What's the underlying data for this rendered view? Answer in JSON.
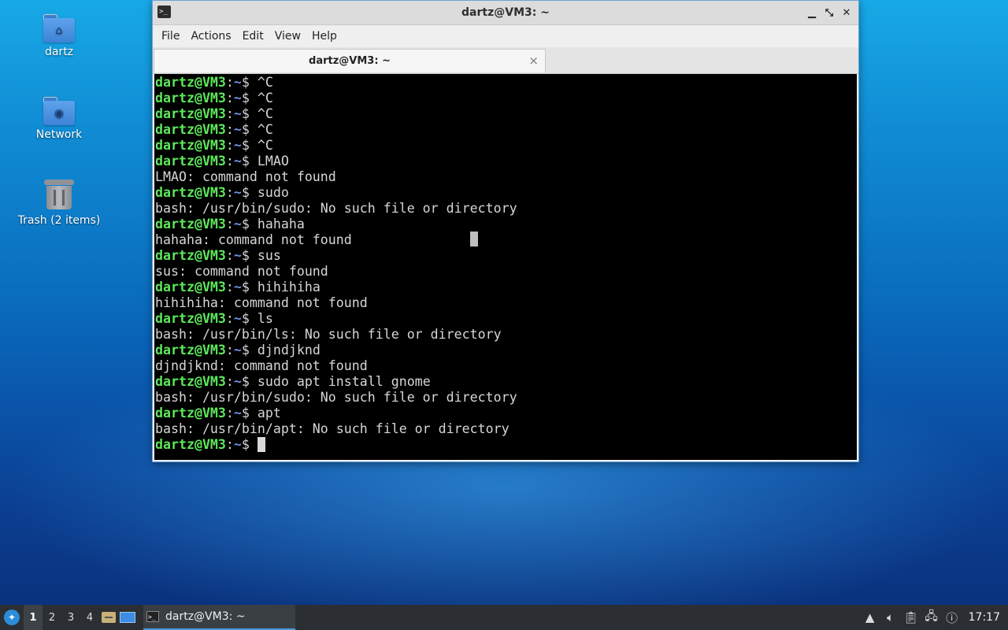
{
  "desktop": {
    "icons": [
      {
        "label": "dartz",
        "icon": "home-folder-icon"
      },
      {
        "label": "Network",
        "icon": "network-folder-icon"
      },
      {
        "label": "Trash (2 items)",
        "icon": "trash-icon"
      }
    ]
  },
  "window": {
    "title": "dartz@VM3: ~",
    "controls": [
      "minimize-icon",
      "maximize-icon",
      "close-icon"
    ],
    "menu": [
      "File",
      "Actions",
      "Edit",
      "View",
      "Help"
    ],
    "tab": {
      "label": "dartz@VM3: ~",
      "close": "×"
    }
  },
  "terminal": {
    "prompt_user": "dartz@VM3",
    "prompt_sep": ":",
    "prompt_path": "~",
    "prompt_end": "$ ",
    "lines": [
      {
        "type": "prompt",
        "cmd": "^C"
      },
      {
        "type": "prompt",
        "cmd": "^C"
      },
      {
        "type": "prompt",
        "cmd": "^C"
      },
      {
        "type": "prompt",
        "cmd": "^C"
      },
      {
        "type": "prompt",
        "cmd": "^C"
      },
      {
        "type": "prompt",
        "cmd": "LMAO"
      },
      {
        "type": "output",
        "text": "LMAO: command not found"
      },
      {
        "type": "prompt",
        "cmd": "sudo"
      },
      {
        "type": "output",
        "text": "bash: /usr/bin/sudo: No such file or directory"
      },
      {
        "type": "prompt",
        "cmd": "hahaha"
      },
      {
        "type": "output",
        "text": "hahaha: command not found"
      },
      {
        "type": "prompt",
        "cmd": "sus"
      },
      {
        "type": "output",
        "text": "sus: command not found"
      },
      {
        "type": "prompt",
        "cmd": "hihihiha"
      },
      {
        "type": "output",
        "text": "hihihiha: command not found"
      },
      {
        "type": "prompt",
        "cmd": "ls"
      },
      {
        "type": "output",
        "text": "bash: /usr/bin/ls: No such file or directory"
      },
      {
        "type": "prompt",
        "cmd": "djndjknd"
      },
      {
        "type": "output",
        "text": "djndjknd: command not found"
      },
      {
        "type": "prompt",
        "cmd": "sudo apt install gnome"
      },
      {
        "type": "output",
        "text": "bash: /usr/bin/sudo: No such file or directory"
      },
      {
        "type": "prompt",
        "cmd": "apt"
      },
      {
        "type": "output",
        "text": "bash: /usr/bin/apt: No such file or directory"
      },
      {
        "type": "prompt",
        "cmd": "",
        "cursor": true
      }
    ]
  },
  "taskbar": {
    "workspaces": [
      "1",
      "2",
      "3",
      "4"
    ],
    "active_workspace": "1",
    "task_label": "dartz@VM3: ~",
    "tray_icons": [
      "scroll-up-icon",
      "volume-icon",
      "clipboard-icon",
      "network-icon",
      "update-notifier-icon"
    ],
    "clock": "17:17"
  },
  "colors": {
    "prompt_user": "#5ee85a",
    "prompt_path": "#6f8fe0",
    "terminal_bg": "#000000",
    "terminal_fg": "#d6d6d6"
  }
}
